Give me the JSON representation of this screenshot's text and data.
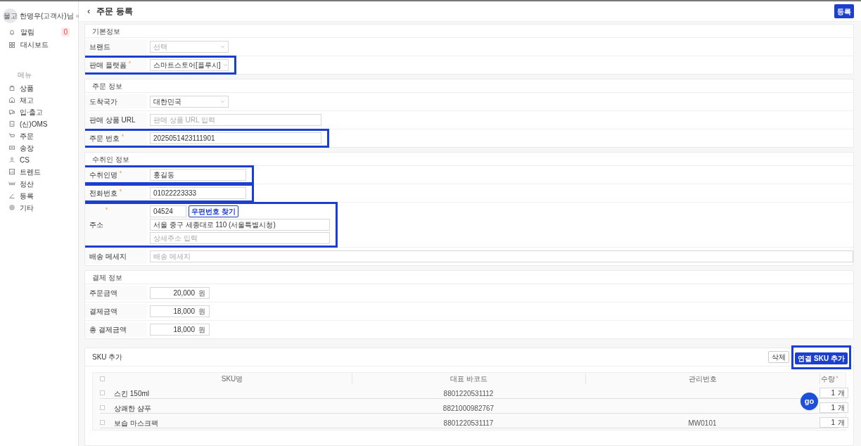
{
  "sidebar": {
    "avatar": "물고",
    "user": "한명우(고객사)님",
    "collapse": "«",
    "items": [
      {
        "label": "알림",
        "badge": "0"
      },
      {
        "label": "대시보드"
      }
    ],
    "menu_title": "메뉴",
    "menu": [
      {
        "label": "상품"
      },
      {
        "label": "재고"
      },
      {
        "label": "입·출고"
      },
      {
        "label": "(신)OMS"
      },
      {
        "label": "주문"
      },
      {
        "label": "송장"
      },
      {
        "label": "CS"
      },
      {
        "label": "트렌드"
      },
      {
        "label": "정산"
      },
      {
        "label": "등록"
      },
      {
        "label": "기타"
      }
    ]
  },
  "header": {
    "back": "‹",
    "title": "주문 등록",
    "submit": "등록"
  },
  "sections": [
    {
      "title": "기본정보",
      "rows": [
        {
          "kind": "select",
          "label": "브랜드",
          "required": false,
          "placeholder": "선택",
          "highlighted": false
        },
        {
          "kind": "select",
          "label": "판매 플랫폼",
          "required": true,
          "value": "스마트스토어[플루시]",
          "highlighted": true
        }
      ]
    },
    {
      "title": "주문 정보",
      "rows": [
        {
          "kind": "select",
          "label": "도착국가",
          "required": false,
          "value": "대한민국",
          "highlighted": false
        },
        {
          "kind": "text",
          "label": "판매 상품 URL",
          "required": false,
          "placeholder": "판매 상품 URL 입력",
          "highlighted": false
        },
        {
          "kind": "text",
          "label": "주문 번호",
          "required": true,
          "value": "2025051423111901",
          "highlighted": true
        }
      ]
    },
    {
      "title": "수취인 정보",
      "rows": [
        {
          "kind": "short",
          "label": "수취인명",
          "required": true,
          "value": "홍길동",
          "highlighted": true
        },
        {
          "kind": "short",
          "label": "전화번호",
          "required": true,
          "value": "01022223333",
          "highlighted": true
        },
        {
          "kind": "address",
          "label": "주소",
          "required": true,
          "postal": "04524",
          "search": "우편번호 찾기",
          "address": "서울 중구 세종대로 110 (서울특별시청)",
          "detail_placeholder": "상세주소 입력",
          "highlighted": true
        },
        {
          "kind": "wide",
          "label": "배송 메세지",
          "required": false,
          "placeholder": "배송 메세지",
          "highlighted": false
        }
      ]
    },
    {
      "title": "결제 정보",
      "rows": [
        {
          "kind": "amount",
          "label": "주문금액",
          "required": false,
          "value": "20,000",
          "unit": "원",
          "highlighted": false
        },
        {
          "kind": "amount",
          "label": "결제금액",
          "required": false,
          "value": "18,000",
          "unit": "원",
          "highlighted": false
        },
        {
          "kind": "amount",
          "label": "총 결제금액",
          "required": false,
          "value": "18,000",
          "unit": "원",
          "highlighted": false
        }
      ]
    }
  ],
  "sku": {
    "title": "SKU 추가",
    "delete": "삭제",
    "add": "연결 SKU 추가",
    "add_highlighted": true,
    "all_checked": false,
    "columns": [
      "SKU명",
      "대표 바코드",
      "관리번호",
      "수량"
    ],
    "qty_required": true,
    "rows": [
      {
        "name": "스킨 150ml",
        "barcode": "8801220531112",
        "code": "",
        "qty": "1",
        "unit": "개",
        "checked": false
      },
      {
        "name": "상쾌한 샴푸",
        "barcode": "8821000982767",
        "code": "",
        "qty": "1",
        "unit": "개",
        "checked": false
      },
      {
        "name": "보습 마스크팩",
        "barcode": "8801220531117",
        "code": "MW0101",
        "qty": "1",
        "unit": "개",
        "checked": false
      }
    ]
  },
  "chat": {
    "label": "go"
  }
}
